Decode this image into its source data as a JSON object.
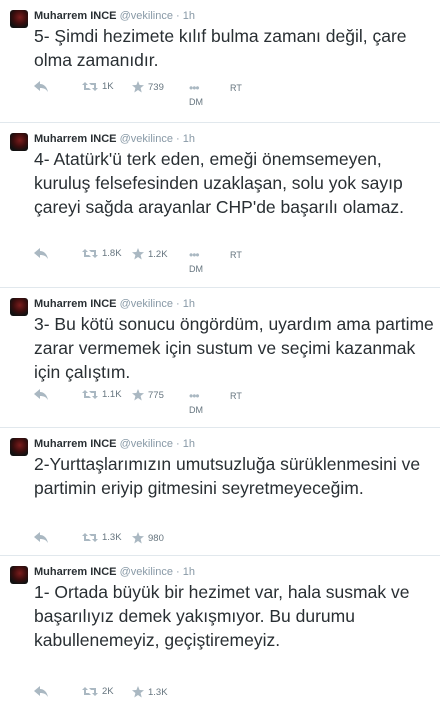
{
  "author": {
    "name": "Muharrem INCE",
    "handle": "@vekilince",
    "separator": "·",
    "time": "1h"
  },
  "labels": {
    "dm": "DM",
    "rt": "RT",
    "more": "•••"
  },
  "tweets": [
    {
      "text": "5- Şimdi hezimete kılıf bulma zamanı değil, çare olma zamanıdır.",
      "retweets": "1K",
      "favorites": "739",
      "show_more": true,
      "show_dm": true,
      "show_rt": true
    },
    {
      "text": "4- Atatürk'ü terk eden, emeği önemsemeyen, kuruluş felsefesinden uzaklaşan, solu yok sayıp çareyi sağda arayanlar CHP'de başarılı olamaz.",
      "retweets": "1.8K",
      "favorites": "1.2K",
      "show_more": true,
      "show_dm": true,
      "show_rt": true
    },
    {
      "text": "3- Bu kötü sonucu öngördüm, uyardım ama partime zarar vermemek için sustum ve seçimi kazanmak için çalıştım.",
      "retweets": "1.1K",
      "favorites": "775",
      "show_more": true,
      "show_dm": true,
      "show_rt": true
    },
    {
      "text": "2-Yurttaşlarımızın umutsuzluğa sürüklenmesini ve partimin eriyip gitmesini seyretmeyeceğim.",
      "retweets": "1.3K",
      "favorites": "980",
      "show_more": false,
      "show_dm": false,
      "show_rt": false
    },
    {
      "text": "1- Ortada büyük bir hezimet var, hala susmak ve başarılıyız demek yakışmıyor. Bu durumu kabullenemeyiz, geçiştiremeyiz.",
      "retweets": "2K",
      "favorites": "1.3K",
      "show_more": false,
      "show_dm": false,
      "show_rt": false
    }
  ]
}
